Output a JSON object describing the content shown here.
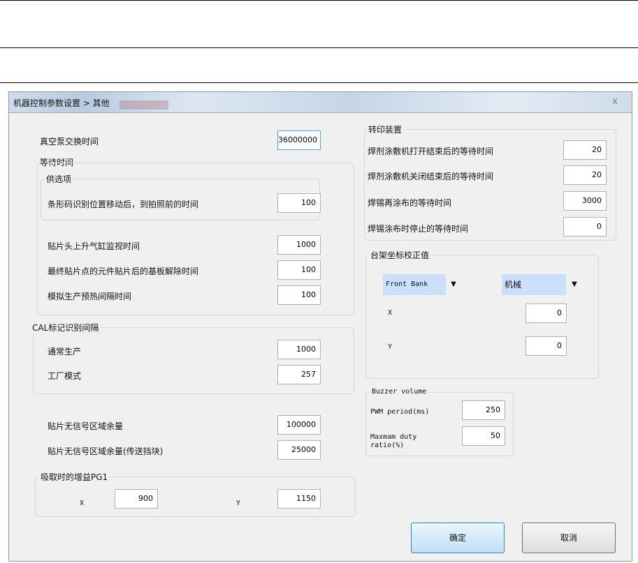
{
  "window": {
    "title": "机器控制参数设置 > 其他",
    "close_glyph": "x"
  },
  "left": {
    "vacuum_label": "真空泵交换时间",
    "vacuum_value": "36000000",
    "wait_group": "等待时间",
    "feeder_group": "供选项",
    "barcode_label": "条形码识别位置移动后，到拍照前的时间",
    "barcode_value": "100",
    "head_up_label": "贴片头上升气缸监视时间",
    "head_up_value": "1000",
    "final_label": "最终贴片点的元件贴片后的基板解除时间",
    "final_value": "100",
    "preheat_label": "模拟生产预热间隔时间",
    "preheat_value": "100",
    "cal_group": "CAL标记识别间隔",
    "normal_label": "通常生产",
    "normal_value": "1000",
    "factory_label": "工厂模式",
    "factory_value": "257",
    "nosignal_label": "贴片无信号区域余量",
    "nosignal_value": "100000",
    "nosignal2_label": "贴片无信号区域余量(传送挡块)",
    "nosignal2_value": "25000",
    "gain_group": "吸取时的增益PG1",
    "gain_x_label": "X",
    "gain_x_value": "900",
    "gain_y_label": "Y",
    "gain_y_value": "1150"
  },
  "right": {
    "transfer_group": "转印装置",
    "open_label": "焊剂涂敷机打开结束后的等待时间",
    "open_value": "20",
    "close_label": "焊剂涂敷机关闭结束后的等待时间",
    "close_value": "20",
    "recoat_label": "焊锡再涂布的等待时间",
    "recoat_value": "3000",
    "stop_label": "焊锡涂布时停止的等待时间",
    "stop_value": "0",
    "stage_group": "台架坐标校正值",
    "bank_select": "Front Bank",
    "mode_select": "机械",
    "x_label": "X",
    "x_value": "0",
    "y_label": "Y",
    "y_value": "0",
    "buzzer_group": "Buzzer volume",
    "pwm_label": "PWM period(ms)",
    "pwm_value": "250",
    "duty_label_1": "Maxmam duty",
    "duty_label_2": "ratio(%)",
    "duty_value": "50"
  },
  "buttons": {
    "ok": "确定",
    "cancel": "取消"
  }
}
